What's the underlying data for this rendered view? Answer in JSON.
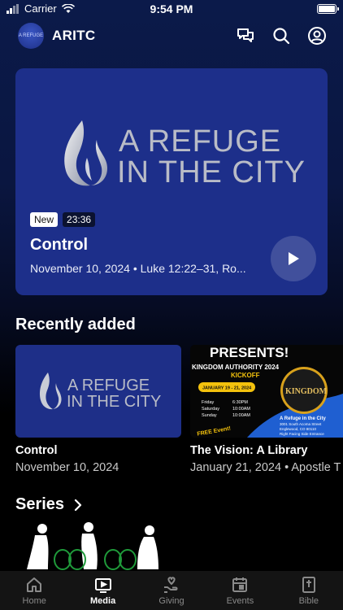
{
  "status": {
    "carrier": "Carrier",
    "time": "9:54 PM"
  },
  "header": {
    "app_title": "ARITC",
    "avatar_text": "A REFUGE"
  },
  "hero": {
    "logo_line1": "A REFUGE",
    "logo_line2": "IN THE CITY",
    "badge_new": "New",
    "duration": "23:36",
    "title": "Control",
    "subtitle": "November 10, 2024 • Luke 12:22–31, Ro..."
  },
  "recently_added": {
    "heading": "Recently added",
    "items": [
      {
        "logo_line1": "A REFUGE",
        "logo_line2": "IN THE CITY",
        "title": "Control",
        "subtitle": "November 10, 2024"
      },
      {
        "poster_heading": "PRESENTS!",
        "poster_line": "KINGDOM AUTHORITY 2024",
        "poster_kickoff": "KICKOFF",
        "poster_dates": "JANUARY 19 - 21, 2024",
        "poster_schedule": [
          {
            "day": "Friday",
            "time": "6:30PM"
          },
          {
            "day": "Saturday",
            "time": "10:00AM"
          },
          {
            "day": "Sunday",
            "time": "10:00AM"
          }
        ],
        "poster_circle_text": "KINGDOM",
        "poster_venue": "A Refuge in the City",
        "poster_address1": "3001 South Acoma Street",
        "poster_address2": "Englewood, CO 80110",
        "poster_address3": "Right Facing Side Entrance",
        "poster_free": "FREE Event!",
        "title": "The Vision:  A Library",
        "subtitle": "January 21, 2024 • Apostle T"
      }
    ]
  },
  "series": {
    "heading": "Series"
  },
  "tabs": [
    {
      "label": "Home",
      "icon": "home-icon",
      "active": false
    },
    {
      "label": "Media",
      "icon": "tv-play-icon",
      "active": true
    },
    {
      "label": "Giving",
      "icon": "hand-heart-icon",
      "active": false
    },
    {
      "label": "Events",
      "icon": "calendar-icon",
      "active": false
    },
    {
      "label": "Bible",
      "icon": "bible-icon",
      "active": false
    }
  ],
  "colors": {
    "hero_bg": "#1d2f8a",
    "background_top": "#0b1a4a",
    "tab_bar": "#141414",
    "poster_yellow": "#f4c20d",
    "poster_blue": "#1f5fd1"
  }
}
